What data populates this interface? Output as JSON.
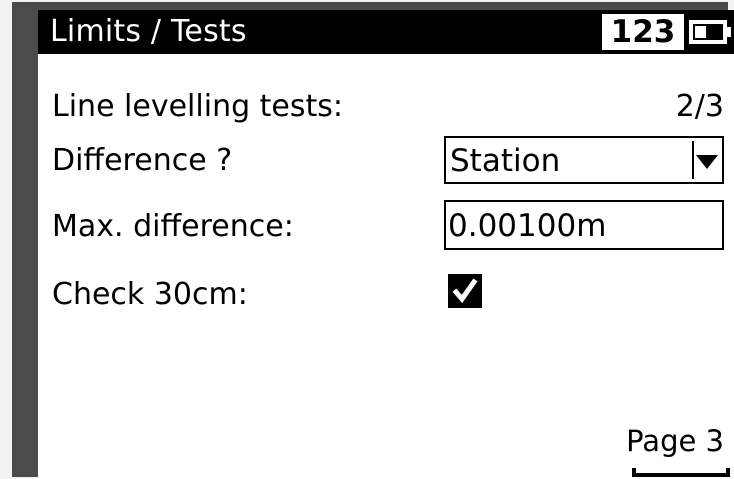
{
  "title_bar": {
    "title": "Limits / Tests",
    "input_mode": "123",
    "battery_icon": "battery-icon"
  },
  "form": {
    "line_tests": {
      "label": "Line levelling tests:",
      "page_indicator": "2/3"
    },
    "difference": {
      "label": "Difference ?",
      "selected_value": "Station",
      "icon": "dropdown-arrow-icon"
    },
    "max_difference": {
      "label": "Max. difference:",
      "value": "0.00100m"
    },
    "check_30cm": {
      "label": "Check 30cm:",
      "checked": true,
      "icon": "checkmark-icon"
    }
  },
  "softkey": {
    "label": "Page 3"
  },
  "colors": {
    "title_bar_background": "#000000",
    "screen_background": "#ffffff",
    "device_bezel": "#4b4b4b"
  }
}
